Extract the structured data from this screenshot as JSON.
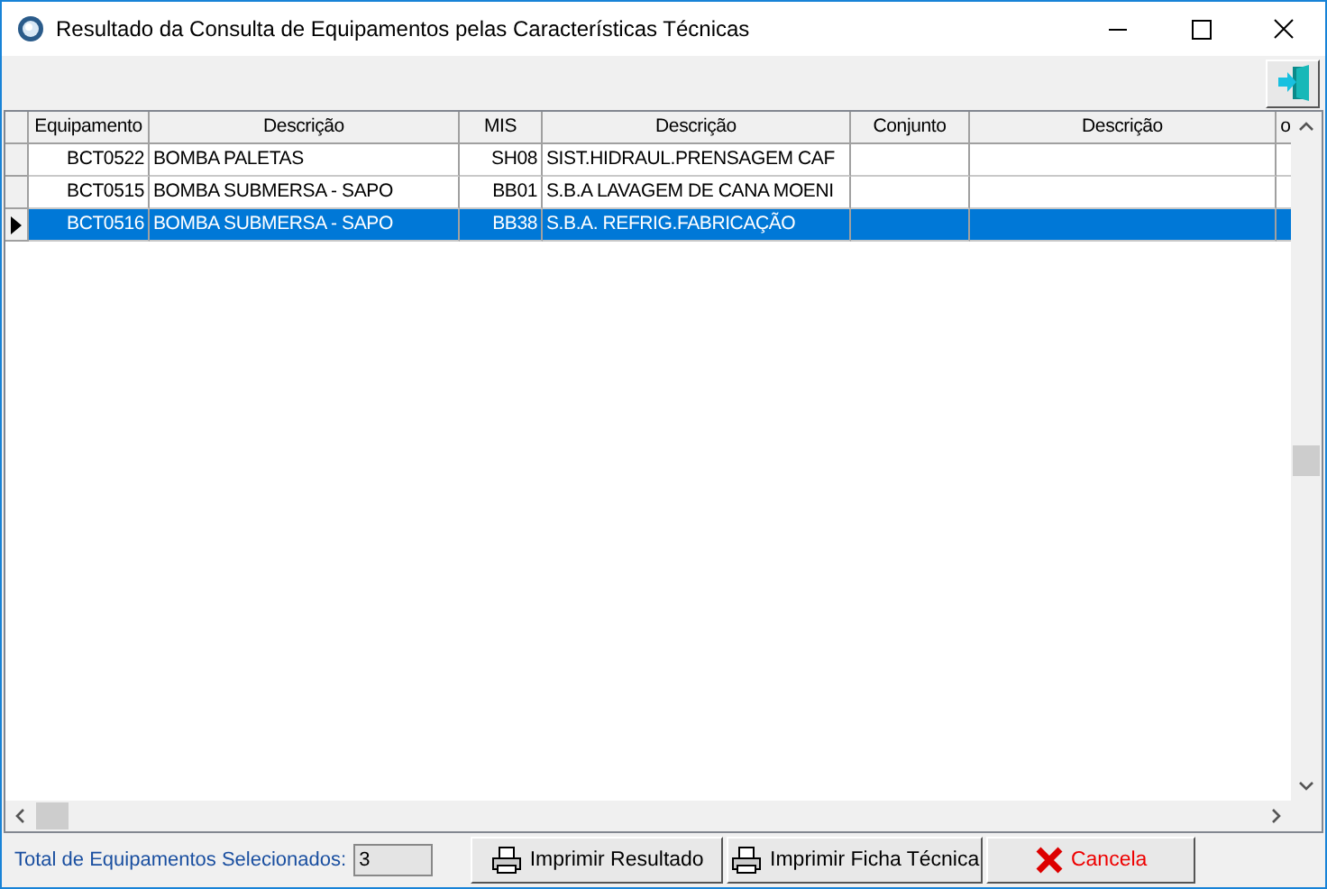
{
  "window": {
    "title": "Resultado da Consulta de Equipamentos pelas Características Técnicas"
  },
  "table": {
    "columns": [
      "Equipamento",
      "Descrição",
      "MIS",
      "Descrição",
      "Conjunto",
      "Descrição",
      "o"
    ],
    "rows": [
      {
        "selected": false,
        "cells": [
          "BCT0522",
          "BOMBA PALETAS",
          "SH08",
          "SIST.HIDRAUL.PRENSAGEM CAF"
        ]
      },
      {
        "selected": false,
        "cells": [
          "BCT0515",
          "BOMBA SUBMERSA - SAPO",
          "BB01",
          "S.B.A LAVAGEM DE CANA MOENI"
        ]
      },
      {
        "selected": true,
        "cells": [
          "BCT0516",
          "BOMBA SUBMERSA - SAPO",
          "BB38",
          "S.B.A. REFRIG.FABRICAÇÃO"
        ]
      }
    ]
  },
  "status": {
    "label": "Total de Equipamentos Selecionados:",
    "value": "3"
  },
  "buttons": [
    {
      "kind": "print",
      "label": "Imprimir Resultado"
    },
    {
      "kind": "print",
      "label": "Imprimir Ficha Técnica"
    },
    {
      "kind": "cancel",
      "label": "Cancela"
    }
  ]
}
